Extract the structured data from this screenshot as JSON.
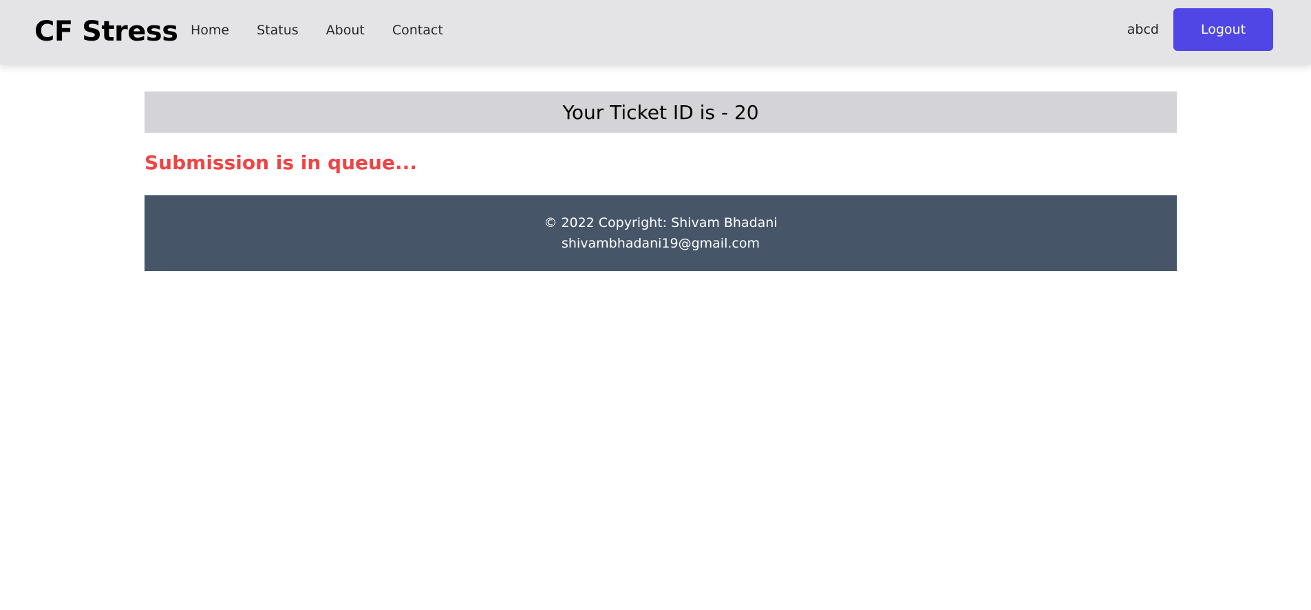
{
  "header": {
    "brand": "CF Stress",
    "nav": [
      {
        "label": "Home"
      },
      {
        "label": "Status"
      },
      {
        "label": "About"
      },
      {
        "label": "Contact"
      }
    ],
    "username": "abcd",
    "logout_label": "Logout"
  },
  "main": {
    "ticket_text": "Your Ticket ID is - 20",
    "status_message": "Submission is in queue..."
  },
  "footer": {
    "copyright": "© 2022 Copyright: Shivam Bhadani",
    "email": "shivambhadani19@gmail.com"
  },
  "colors": {
    "navbar_bg": "#e4e4e7",
    "accent": "#4f46e5",
    "ticket_bg": "#d4d4d8",
    "status_red": "#ef4444",
    "footer_bg": "#475569"
  }
}
